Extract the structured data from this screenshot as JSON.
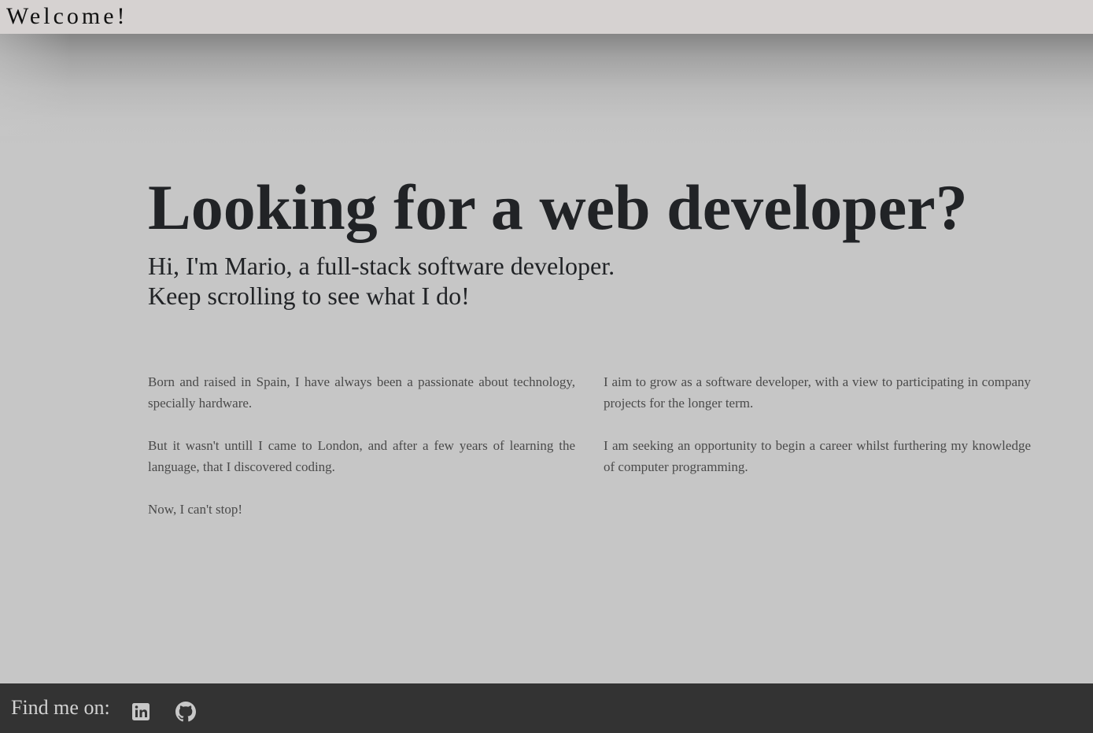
{
  "header": {
    "title": "Welcome!"
  },
  "hero": {
    "title": "Looking for a web developer?",
    "subtitle_line1": "Hi, I'm Mario, a full-stack software developer.",
    "subtitle_line2": "Keep scrolling to see what I do!"
  },
  "about": {
    "left": [
      "Born and raised in Spain, I have always been a passionate about technology, specially hardware.",
      "But it wasn't untill I came to London, and after a few years of learning the language, that I discovered coding.",
      "Now, I can't stop!"
    ],
    "right": [
      "I aim to grow as a software developer, with a view to participating in company projects for the longer term.",
      "I am seeking an opportunity to begin a career whilst furthering my knowledge of computer programming."
    ]
  },
  "footer": {
    "label": "Find me on:",
    "icons": [
      "linkedin-icon",
      "github-icon"
    ]
  },
  "colors": {
    "topbar": "#d6d2d1",
    "background": "#c6c6c6",
    "footer": "#333333",
    "heading": "#212326"
  }
}
